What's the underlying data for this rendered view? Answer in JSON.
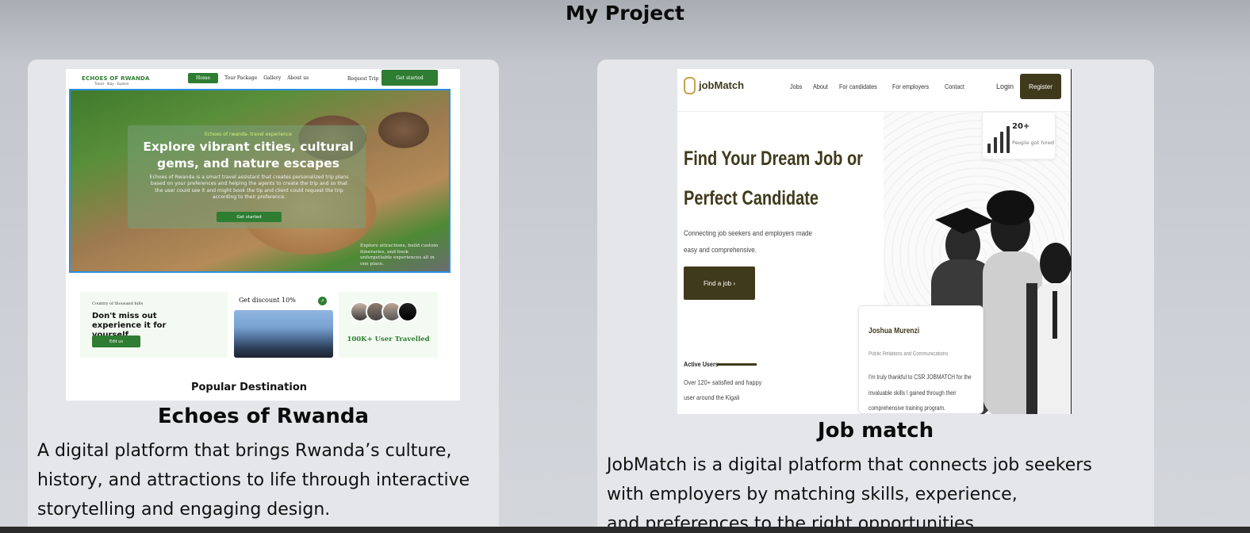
{
  "page": {
    "title": "My Project"
  },
  "projects": [
    {
      "title": "Echoes of Rwanda",
      "description": "A digital platform that brings Rwanda’s culture, history, and attractions to life through interactive storytelling and engaging design.",
      "screenshot": {
        "logo": "ECHOES OF RWANDA",
        "logo_sub": "Travel · Stay · Explore",
        "nav": [
          "Home",
          "Tour Package",
          "Gallery",
          "About us"
        ],
        "request_trip": "Request Trip",
        "get_started": "Get started",
        "hero_eyebrow": "Echoes of rwanda- travel experience",
        "hero_title_line1": "Explore vibrant cities, cultural",
        "hero_title_line2": "gems, and nature escapes",
        "hero_text": "Echoes of Rwanda is a smart travel assistant that creates personalized trip plans based on your preferences and helping the agents to create the trip and so that the user could see it and might book the tip and client could request the trip according to their preference.",
        "hero_button": "Get started",
        "hero_side": "Explore attractions, build custom itineraries, and book unforgettable experiences all in one place.",
        "card1_small": "Country of thousand hills",
        "card1_title": "Don't miss out experience it for yourself.",
        "card1_button": "Edit us",
        "card2_title": "Get discount 10%",
        "card2_arrow": "↗",
        "card3_text": "100K+ User Travelled",
        "popular": "Popular Destination"
      }
    },
    {
      "title": "Job match",
      "description_line1": "JobMatch is a digital platform that connects job seekers",
      "description_line2": "with employers by matching skills, experience,",
      "description_line3": "and preferences to the right opportunities.",
      "screenshot": {
        "logo": "jobMatch",
        "nav": [
          "Jobs",
          "About",
          "For candidates",
          "For employers",
          "Contact"
        ],
        "login": "Login",
        "register": "Register",
        "headline_line1": "Find Your Dream Job or",
        "headline_line2": "Perfect Candidate",
        "subtext": "Connecting job seekers and employers made easy and comprehensive.",
        "cta": "Find a job  ›",
        "active_users_label": "Active Users",
        "active_users_text": "Over 120+ satisfied and happy user around the Kigali",
        "stat_number": "20+",
        "stat_label": "People got hired",
        "testimonial_name": "Joshua Murenzi",
        "testimonial_role": "Public Relations and Communications",
        "testimonial_text": "I'm truly thankful to CSR JOBMATCH for the invaluable skills I gained through their comprehensive training program."
      }
    }
  ],
  "colors": {
    "echoes_green": "#2e7d32",
    "jobmatch_brown": "#3f3a1c",
    "card_bg": "#e5e6e9",
    "highlight_border": "#2b8fe0"
  }
}
